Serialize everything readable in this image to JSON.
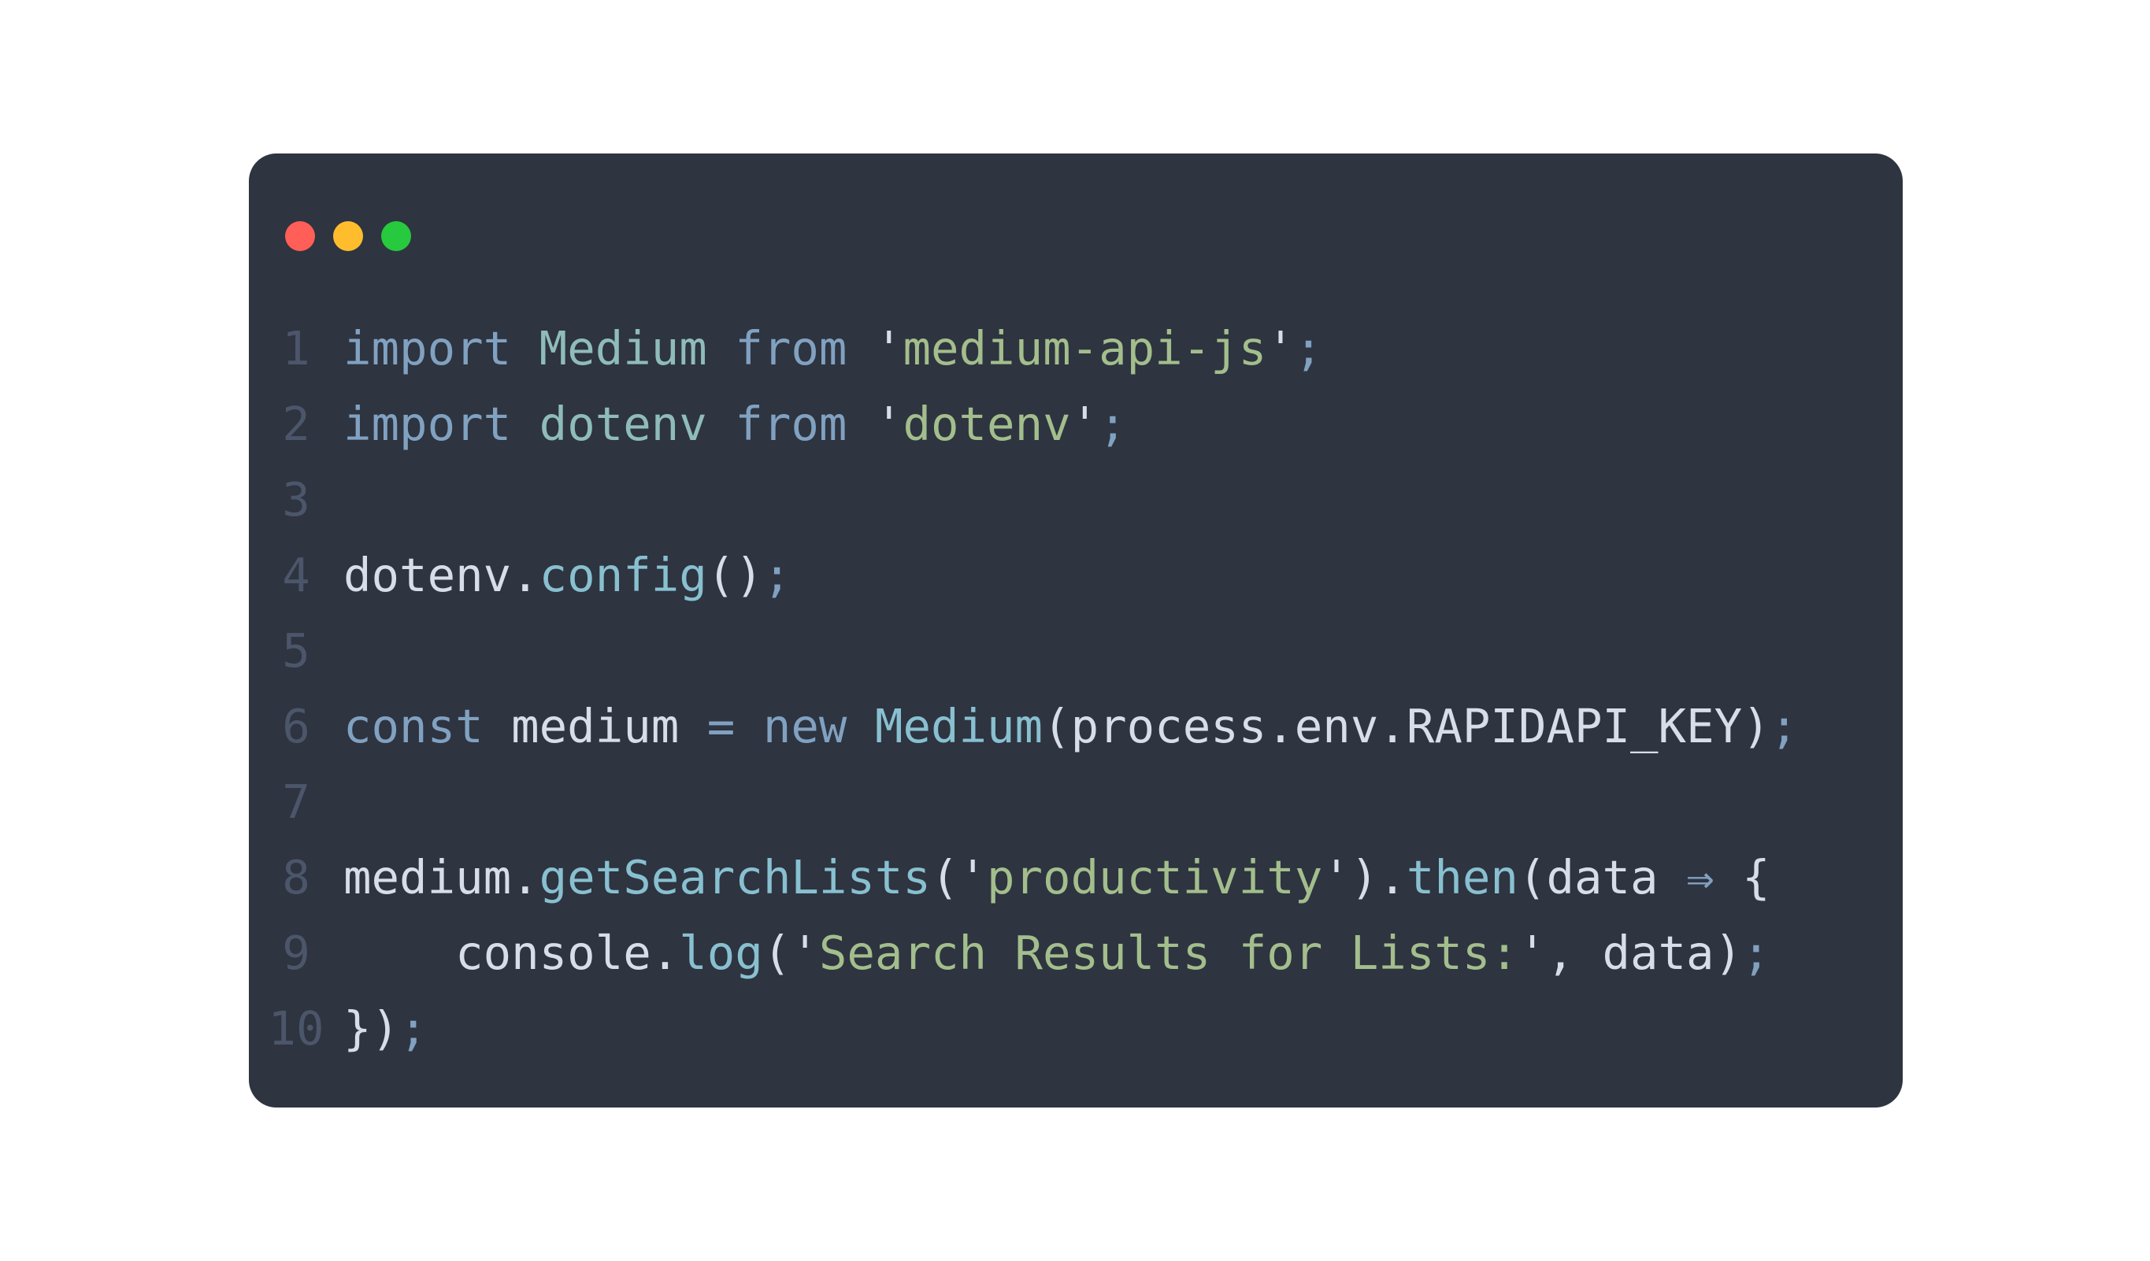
{
  "window": {
    "traffic_lights": [
      {
        "name": "close",
        "color": "#ff5f56"
      },
      {
        "name": "minimize",
        "color": "#ffbd2e"
      },
      {
        "name": "maximize",
        "color": "#27c93f"
      }
    ]
  },
  "code": {
    "language": "javascript",
    "lines": [
      {
        "number": "1",
        "tokens": [
          {
            "t": "import",
            "c": "kw"
          },
          {
            "t": " ",
            "c": "pl"
          },
          {
            "t": "Medium",
            "c": "id"
          },
          {
            "t": " ",
            "c": "pl"
          },
          {
            "t": "from",
            "c": "kw"
          },
          {
            "t": " '",
            "c": "pl"
          },
          {
            "t": "medium-api-js",
            "c": "str"
          },
          {
            "t": "'",
            "c": "pl"
          },
          {
            "t": ";",
            "c": "kw"
          }
        ]
      },
      {
        "number": "2",
        "tokens": [
          {
            "t": "import",
            "c": "kw"
          },
          {
            "t": " ",
            "c": "pl"
          },
          {
            "t": "dotenv",
            "c": "id"
          },
          {
            "t": " ",
            "c": "pl"
          },
          {
            "t": "from",
            "c": "kw"
          },
          {
            "t": " '",
            "c": "pl"
          },
          {
            "t": "dotenv",
            "c": "str"
          },
          {
            "t": "'",
            "c": "pl"
          },
          {
            "t": ";",
            "c": "kw"
          }
        ]
      },
      {
        "number": "3",
        "tokens": []
      },
      {
        "number": "4",
        "tokens": [
          {
            "t": "dotenv.",
            "c": "pl"
          },
          {
            "t": "config",
            "c": "fn"
          },
          {
            "t": "()",
            "c": "pl"
          },
          {
            "t": ";",
            "c": "kw"
          }
        ]
      },
      {
        "number": "5",
        "tokens": []
      },
      {
        "number": "6",
        "tokens": [
          {
            "t": "const",
            "c": "kw"
          },
          {
            "t": " medium ",
            "c": "pl"
          },
          {
            "t": "=",
            "c": "kw"
          },
          {
            "t": " ",
            "c": "pl"
          },
          {
            "t": "new",
            "c": "kw"
          },
          {
            "t": " ",
            "c": "pl"
          },
          {
            "t": "Medium",
            "c": "fn"
          },
          {
            "t": "(process.env.RAPIDAPI_KEY)",
            "c": "pl"
          },
          {
            "t": ";",
            "c": "kw"
          }
        ]
      },
      {
        "number": "7",
        "tokens": []
      },
      {
        "number": "8",
        "tokens": [
          {
            "t": "medium.",
            "c": "pl"
          },
          {
            "t": "getSearchLists",
            "c": "fn"
          },
          {
            "t": "('",
            "c": "pl"
          },
          {
            "t": "productivity",
            "c": "str"
          },
          {
            "t": "').",
            "c": "pl"
          },
          {
            "t": "then",
            "c": "fn"
          },
          {
            "t": "(data ",
            "c": "pl"
          },
          {
            "t": "⇒",
            "c": "kw"
          },
          {
            "t": " {",
            "c": "pl"
          }
        ]
      },
      {
        "number": "9",
        "tokens": [
          {
            "t": "    console.",
            "c": "pl"
          },
          {
            "t": "log",
            "c": "fn"
          },
          {
            "t": "('",
            "c": "pl"
          },
          {
            "t": "Search Results for Lists:",
            "c": "str"
          },
          {
            "t": "', data)",
            "c": "pl"
          },
          {
            "t": ";",
            "c": "kw"
          }
        ]
      },
      {
        "number": "10",
        "tokens": [
          {
            "t": "})",
            "c": "pl"
          },
          {
            "t": ";",
            "c": "kw"
          }
        ]
      }
    ]
  }
}
